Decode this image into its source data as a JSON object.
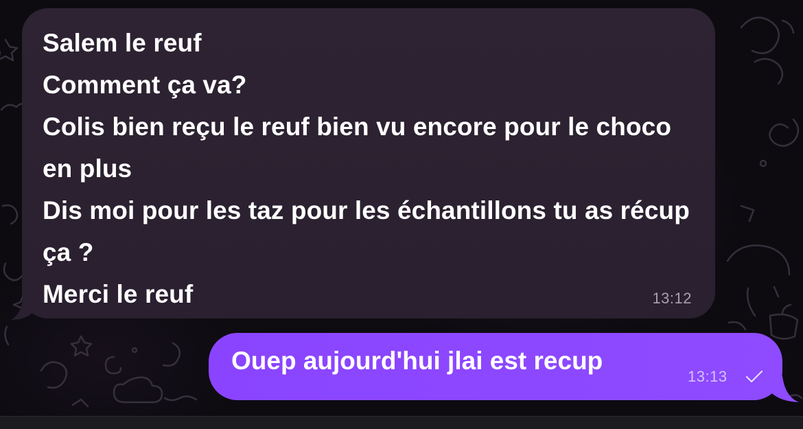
{
  "messages": [
    {
      "direction": "incoming",
      "text": "Salem le reuf\nComment ça va?\nColis bien reçu le reuf bien vu encore pour le choco en plus\nDis moi pour les taz pour les échantillons tu as récup ça ?\nMerci le reuf",
      "time": "13:12"
    },
    {
      "direction": "outgoing",
      "text": "Ouep aujourd'hui jlai est recup",
      "time": "13:13",
      "status_icon": "single-check-icon"
    }
  ],
  "colors": {
    "incoming_bubble": "#2b2130",
    "outgoing_bubble": "#8b45ff",
    "background": "#0d0b10",
    "incoming_time": "#a99fb0",
    "outgoing_time": "#d4c2ff"
  }
}
